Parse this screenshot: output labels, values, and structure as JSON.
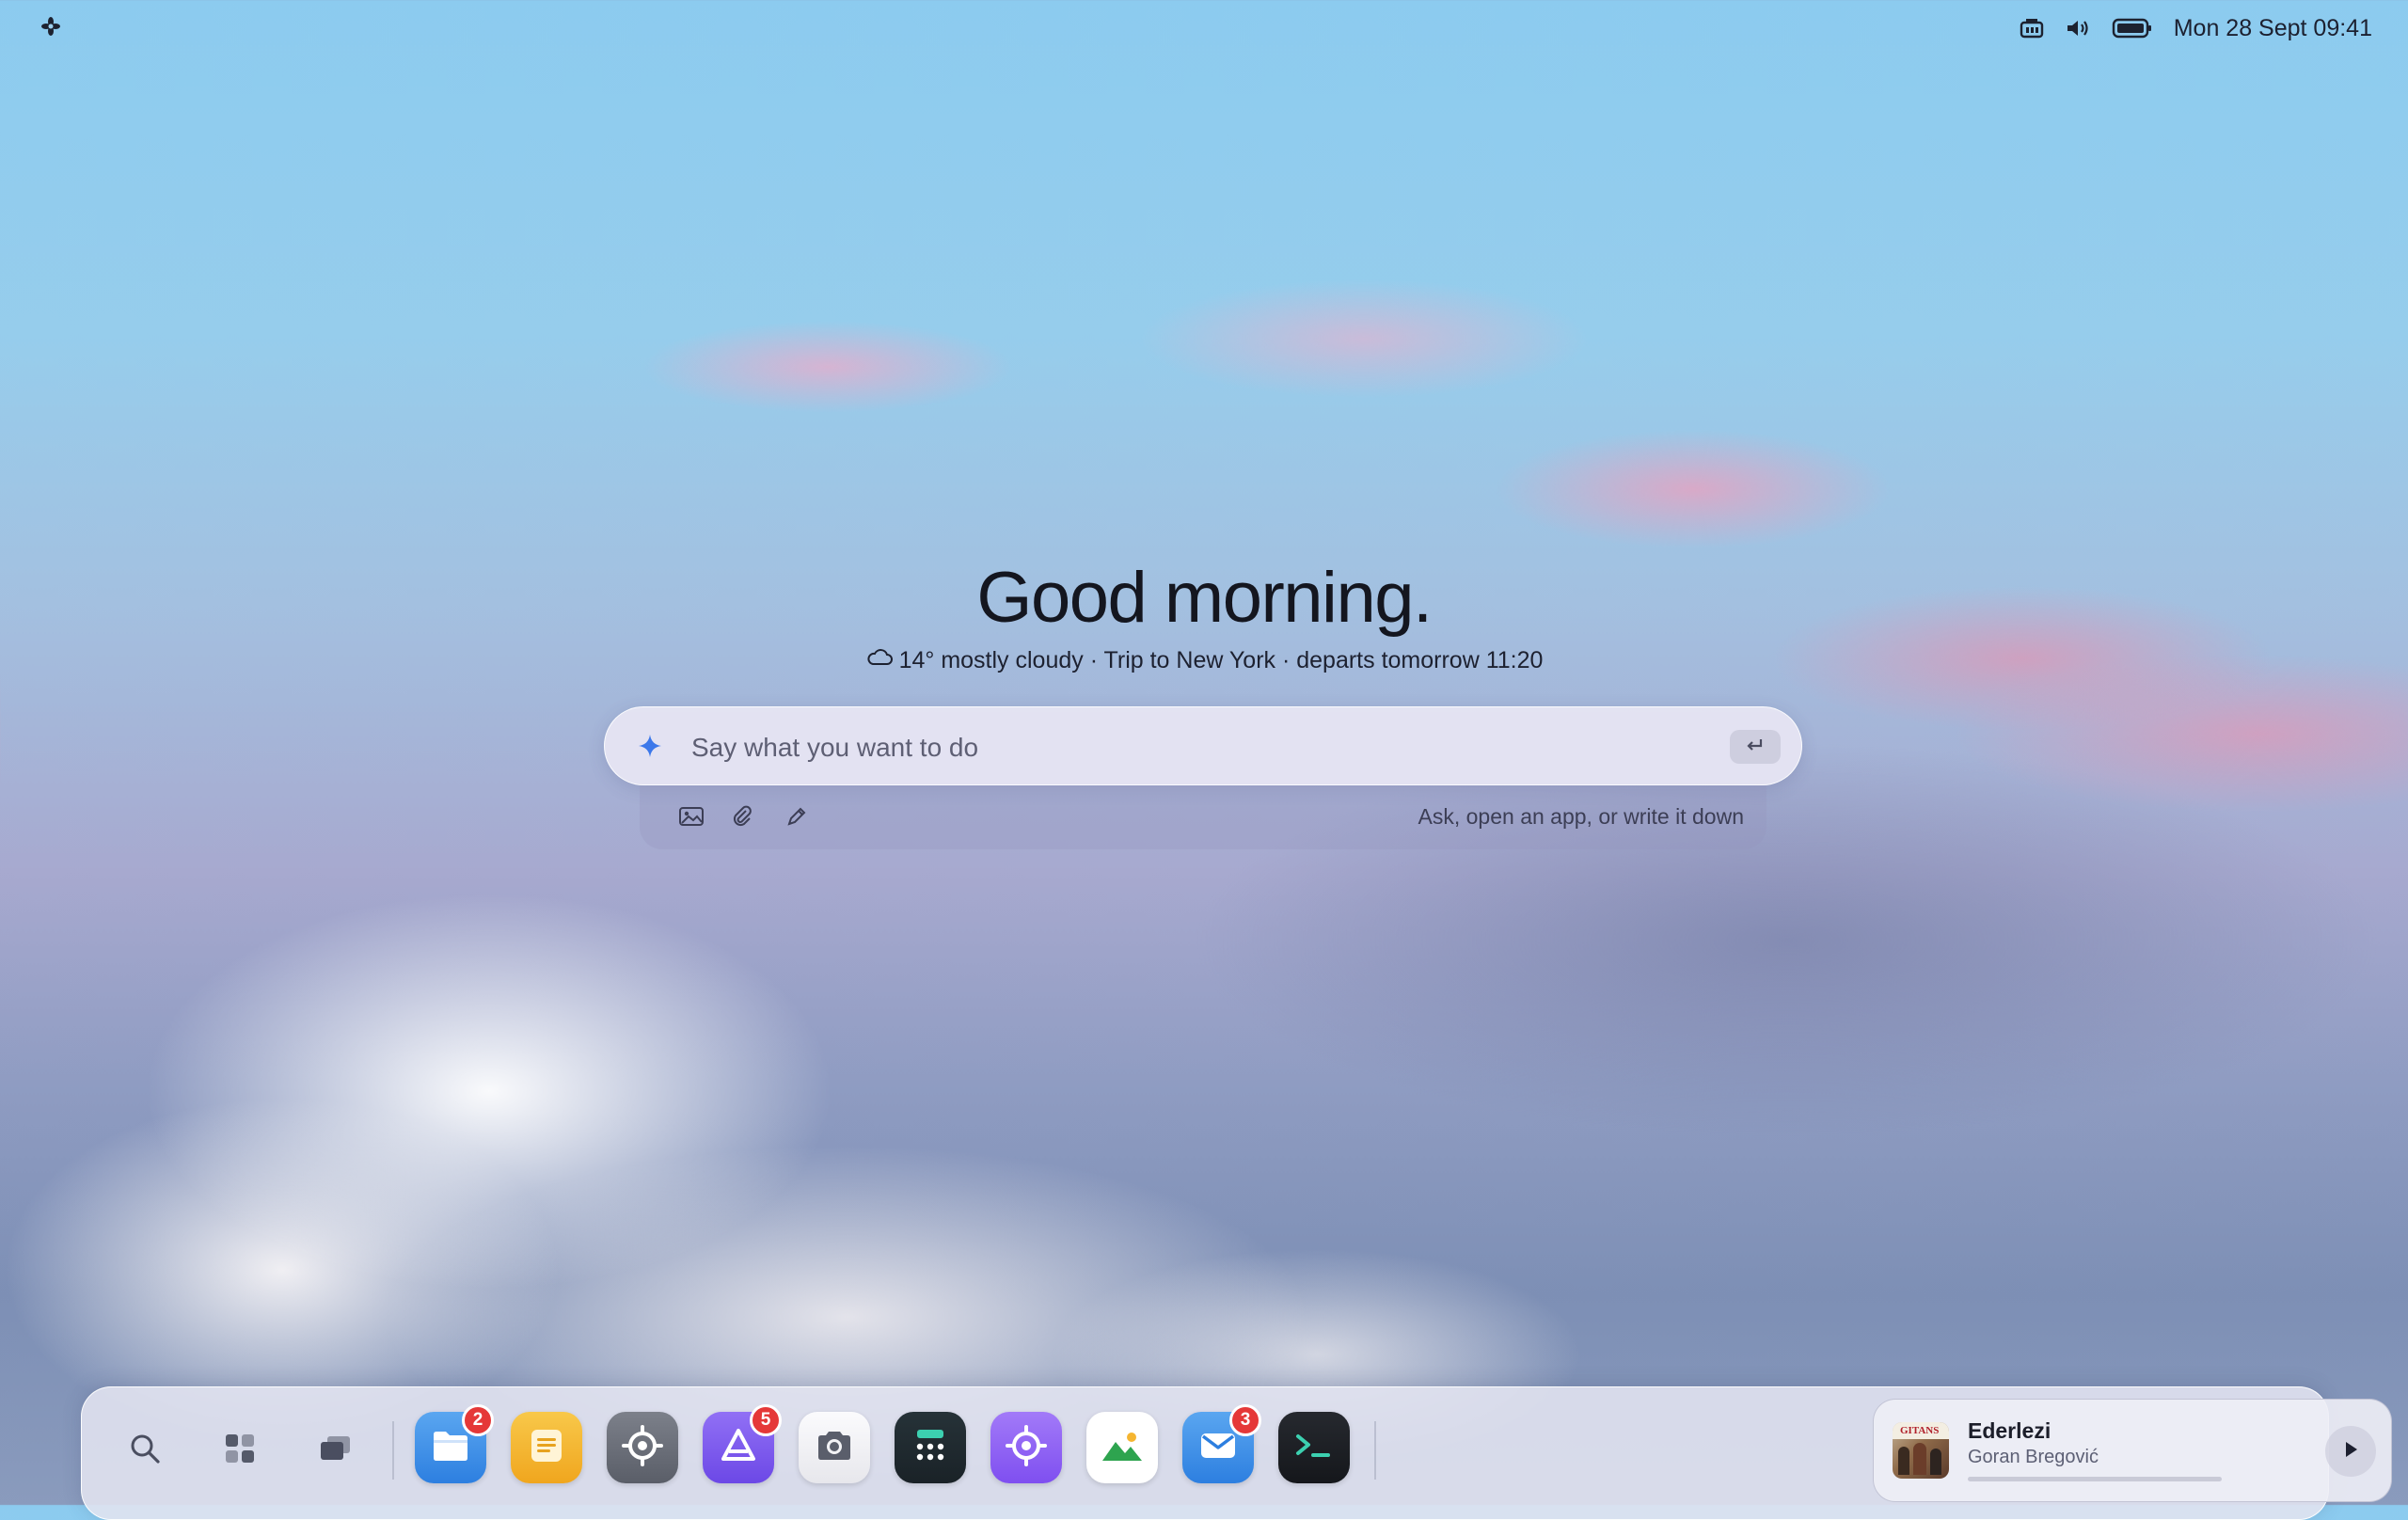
{
  "topbar": {
    "logo_icon": "system-logo-icon",
    "status_icons": [
      "network-icon",
      "volume-icon",
      "battery-icon"
    ],
    "clock": "Mon 28 Sept 09:41"
  },
  "home": {
    "greeting": "Good morning.",
    "weather_icon": "cloud-icon",
    "summary": "14° mostly cloudy · Trip to New York · departs tomorrow 11:20"
  },
  "prompt": {
    "placeholder": "Say what you want to do",
    "hint": "Ask, open an app, or write it down",
    "tools": [
      "image-icon",
      "attachment-icon",
      "pen-icon"
    ]
  },
  "dock": {
    "left_buttons": [
      "search",
      "app-grid",
      "windows"
    ],
    "apps": [
      {
        "name": "files",
        "color": "#3d8fe8",
        "badge": "2"
      },
      {
        "name": "notes",
        "color": "#f3b42f",
        "badge": ""
      },
      {
        "name": "settings",
        "color": "#6a6e78",
        "badge": ""
      },
      {
        "name": "app-store",
        "color": "#7b5ef0",
        "badge": "5"
      },
      {
        "name": "camera",
        "color": "#f2f2f5",
        "badge": ""
      },
      {
        "name": "calculator",
        "color": "#1e2a30",
        "badge": ""
      },
      {
        "name": "maps",
        "color": "#8a5cf2",
        "badge": ""
      },
      {
        "name": "photos",
        "color": "#ffffff",
        "badge": ""
      },
      {
        "name": "mail",
        "color": "#3d8fe8",
        "badge": "3"
      },
      {
        "name": "terminal",
        "color": "#1c1f24",
        "badge": ""
      }
    ],
    "media": {
      "title": "Ederlezi",
      "artist": "Goran Bregović",
      "progress": 0.0
    }
  }
}
